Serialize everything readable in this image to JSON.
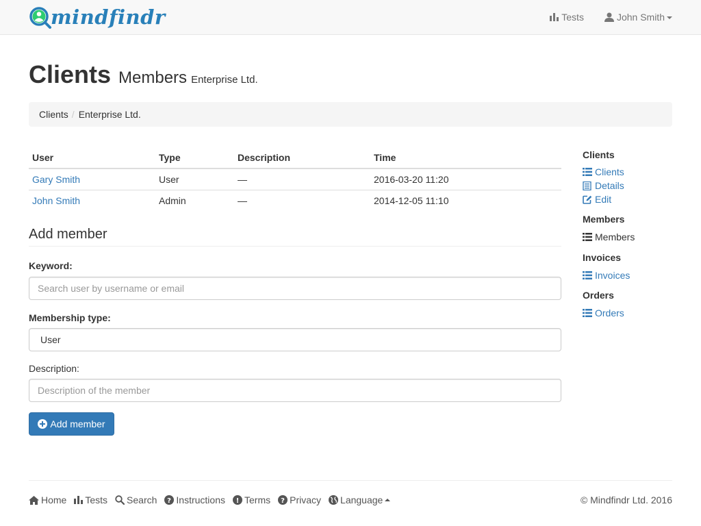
{
  "brand": {
    "name": "mindfindr",
    "color": "#2980b9"
  },
  "navbar": {
    "tests_label": "Tests",
    "user_label": "John Smith"
  },
  "header": {
    "title": "Clients",
    "subtitle": "Members",
    "small": "Enterprise Ltd."
  },
  "breadcrumb": {
    "items": [
      "Clients",
      "Enterprise Ltd."
    ],
    "separator": "/"
  },
  "table": {
    "columns": [
      "User",
      "Type",
      "Description",
      "Time"
    ],
    "rows": [
      {
        "user": "Gary Smith",
        "type": "User",
        "description": "—",
        "time": "2016-03-20 11:20"
      },
      {
        "user": "John Smith",
        "type": "Admin",
        "description": "—",
        "time": "2014-12-05 11:10"
      }
    ]
  },
  "form": {
    "title": "Add member",
    "keyword_label": "Keyword:",
    "keyword_placeholder": "Search user by username or email",
    "keyword_value": "",
    "membership_label": "Membership type:",
    "membership_value": "User",
    "description_label": "Description:",
    "description_placeholder": "Description of the member",
    "description_value": "",
    "submit_label": "Add member"
  },
  "sidebar": {
    "sections": [
      {
        "heading": "Clients",
        "items": [
          {
            "label": "Clients",
            "icon": "list-icon",
            "active": false
          },
          {
            "label": "Details",
            "icon": "document-icon",
            "active": false
          },
          {
            "label": "Edit",
            "icon": "edit-icon",
            "active": false
          }
        ]
      },
      {
        "heading": "Members",
        "items": [
          {
            "label": "Members",
            "icon": "list-icon",
            "active": true
          }
        ]
      },
      {
        "heading": "Invoices",
        "items": [
          {
            "label": "Invoices",
            "icon": "list-icon",
            "active": false
          }
        ]
      },
      {
        "heading": "Orders",
        "items": [
          {
            "label": "Orders",
            "icon": "list-icon",
            "active": false
          }
        ]
      }
    ]
  },
  "footer": {
    "links": [
      {
        "label": "Home",
        "icon": "home-icon"
      },
      {
        "label": "Tests",
        "icon": "bar-chart-icon"
      },
      {
        "label": "Search",
        "icon": "search-icon"
      },
      {
        "label": "Instructions",
        "icon": "question-icon"
      },
      {
        "label": "Terms",
        "icon": "info-icon"
      },
      {
        "label": "Privacy",
        "icon": "question-icon"
      },
      {
        "label": "Language",
        "icon": "globe-icon"
      }
    ],
    "copyright": "© Mindfindr Ltd. 2016"
  },
  "colors": {
    "link": "#337ab7",
    "primary_button": "#337ab7",
    "navbar_bg": "#f8f8f8",
    "brand_green": "#2ecc71"
  }
}
